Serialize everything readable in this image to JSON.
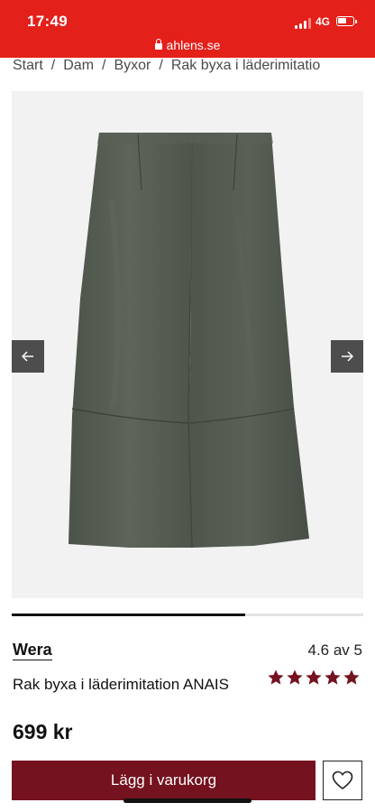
{
  "status_bar": {
    "time": "17:49",
    "network": "4G",
    "url": "ahlens.se",
    "background_color": "#e4201b"
  },
  "breadcrumb": {
    "items": [
      "Start",
      "Dam",
      "Byxor",
      "Rak byxa i läderimitatio"
    ],
    "separator": "/"
  },
  "gallery": {
    "image_icon": "trousers-image",
    "prev_icon": "arrow-left-icon",
    "next_icon": "arrow-right-icon",
    "progress_fraction": 0.665
  },
  "product": {
    "brand": "Wera",
    "name": "Rak byxa i läderimitation ANAIS",
    "rating_text": "4.6 av 5",
    "rating_stars": 5,
    "star_color": "#74121f",
    "price": "699 kr",
    "product_color": "#535a4f"
  },
  "actions": {
    "add_to_cart_label": "Lägg i varukorg",
    "add_to_cart_color": "#74121f",
    "wishlist_icon": "heart-icon"
  }
}
